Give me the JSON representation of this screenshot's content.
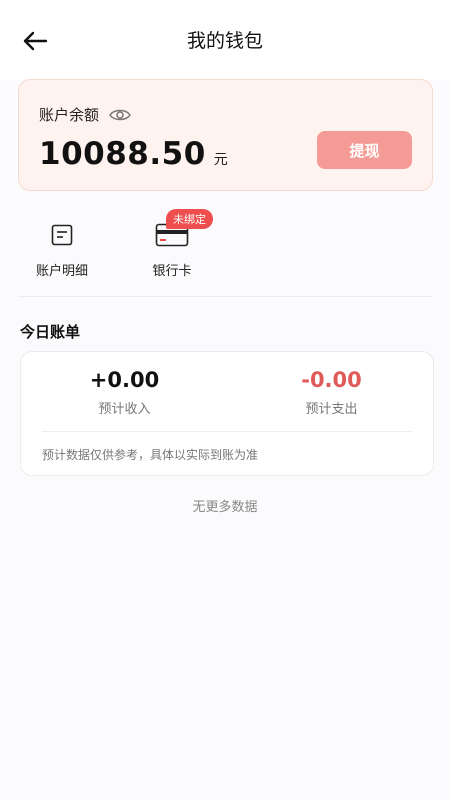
{
  "header": {
    "title": "我的钱包"
  },
  "balance": {
    "label": "账户余额",
    "amount": "10088.50",
    "unit": "元",
    "withdraw_label": "提现"
  },
  "shortcuts": [
    {
      "label": "账户明细",
      "icon": "document-icon"
    },
    {
      "label": "银行卡",
      "icon": "bank-card-icon",
      "badge": "未绑定"
    }
  ],
  "today_bill": {
    "title": "今日账单",
    "income_value": "+0.00",
    "income_label": "预计收入",
    "expense_value": "-0.00",
    "expense_label": "预计支出",
    "note": "预计数据仅供参考，具体以实际到账为准"
  },
  "footer": {
    "no_more": "无更多数据"
  },
  "colors": {
    "accent": "#f49b96",
    "badge": "#ee4e4e",
    "expense": "#e05a5a",
    "card_bg": "#fef3ee"
  }
}
